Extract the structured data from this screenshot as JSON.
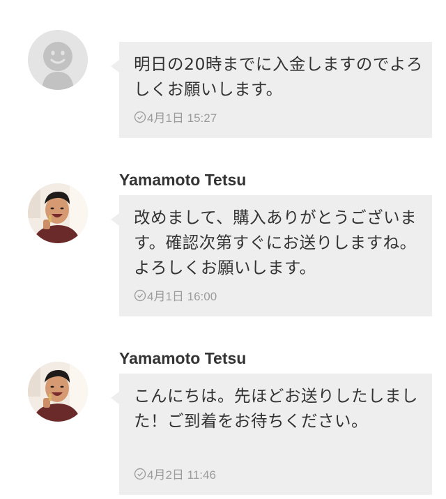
{
  "messages": [
    {
      "sender": "",
      "avatar": "default-avatar-icon",
      "text": "明日の20時までに入金しますのでよろしくお願いします。",
      "time": "4月1日 15:27"
    },
    {
      "sender": "Yamamoto Tetsu",
      "avatar": "user-photo-avatar",
      "text": "改めまして、購入ありがとうございます。確認次第すぐにお送りしますね。よろしくお願いします。",
      "time": "4月1日 16:00"
    },
    {
      "sender": "Yamamoto Tetsu",
      "avatar": "user-photo-avatar",
      "text": "こんにちは。先ほどお送りしたしました！ご到着をお待ちください。",
      "time": "4月2日 11:46"
    }
  ],
  "colors": {
    "bubble": "#eeeeee",
    "timestamp": "#9b9b9b",
    "text": "#333333"
  }
}
